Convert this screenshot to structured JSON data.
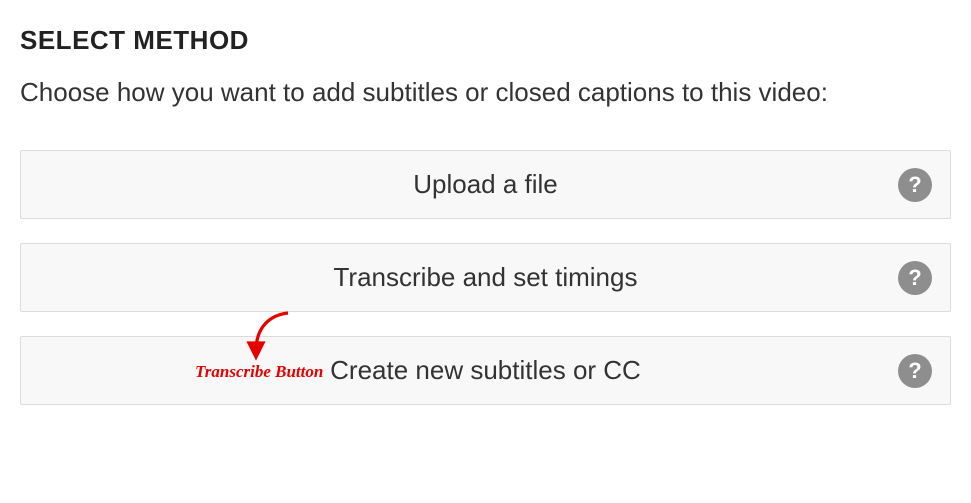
{
  "heading": "SELECT METHOD",
  "description": "Choose how you want to add subtitles or closed captions to this video:",
  "options": [
    {
      "label": "Upload a file"
    },
    {
      "label": "Transcribe and set timings"
    },
    {
      "label": "Create new subtitles or CC"
    }
  ],
  "help_icon_glyph": "?",
  "annotation": "Transcribe Button",
  "colors": {
    "accent": "#e60000",
    "button_bg": "#f8f8f8",
    "border": "#dcdcdc",
    "help_bg": "#8e8e8e"
  }
}
